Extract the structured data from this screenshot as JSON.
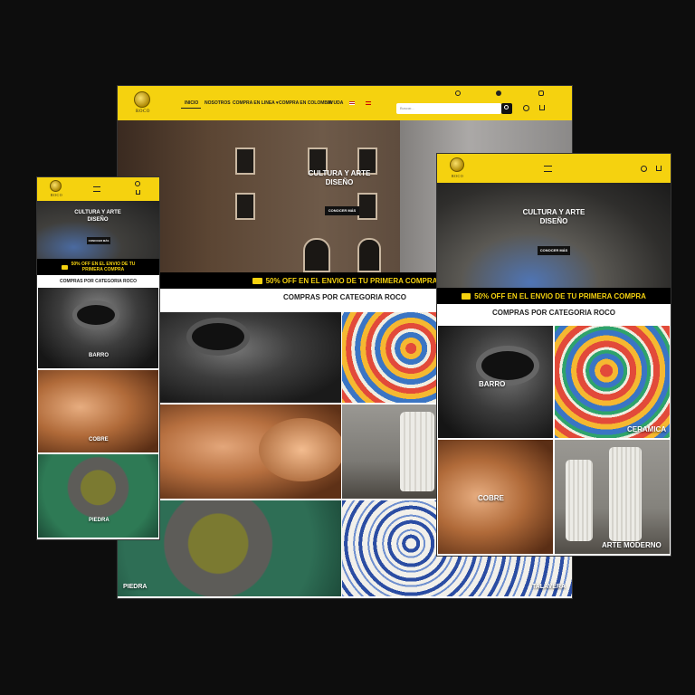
{
  "brand": {
    "logo_text": "ROCO"
  },
  "desktop": {
    "nav": [
      "INICIO",
      "NOSOTROS",
      "COMPRA EN LINEA",
      "COMPRA EN COLOMBIA",
      "AYUDA"
    ],
    "search_placeholder": "Buscar...",
    "hero_title_line1": "CULTURA Y ARTE",
    "hero_title_line2": "DISEÑO",
    "hero_button": "CONOCER MÁS",
    "promo": "50% OFF EN EL ENVIO DE TU PRIMERA COMPRA",
    "categories_title": "COMPRAS POR CATEGORIA ROCO",
    "tiles": {
      "piedra": "PIEDRA",
      "talavera": "TALAVERA"
    }
  },
  "mobile": {
    "hero_title_line1": "CULTURA Y ARTE",
    "hero_title_line2": "DISEÑO",
    "hero_button": "CONOCER MÁS",
    "promo_line1": "50% OFF EN EL ENVIO DE TU",
    "promo_line2": "PRIMERA COMPRA",
    "categories_title": "COMPRAS POR CATEGORIA ROCO",
    "tiles": {
      "barro": "BARRO",
      "cobre": "COBRE",
      "piedra": "PIEDRA"
    }
  },
  "tablet": {
    "hero_title_line1": "CULTURA Y ARTE",
    "hero_title_line2": "DISEÑO",
    "hero_button": "CONOCER MÁS",
    "promo": "50% OFF EN EL ENVIO DE TU PRIMERA COMPRA",
    "categories_title": "COMPRAS POR CATEGORIA ROCO",
    "tiles": {
      "barro": "BARRO",
      "ceramica": "CERAMICA",
      "cobre": "COBRE",
      "arte_moderno": "ARTE MODERNO"
    }
  },
  "colors": {
    "accent": "#f5d20f",
    "dark": "#000000",
    "background": "#0d0d0d"
  }
}
